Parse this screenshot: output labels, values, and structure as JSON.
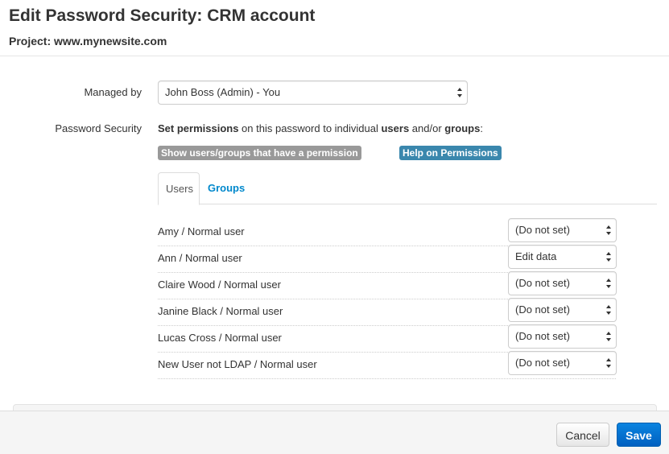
{
  "header": {
    "title": "Edit Password Security: CRM account",
    "subtitle": "Project: www.mynewsite.com"
  },
  "managed_by": {
    "label": "Managed by",
    "value": "John Boss (Admin) - You"
  },
  "password_security": {
    "label": "Password Security",
    "text_prefix_bold": "Set permissions",
    "text_middle": " on this password to individual ",
    "text_users_bold": "users",
    "text_andor": " and/or ",
    "text_groups_bold": "groups",
    "text_suffix": ":",
    "show_button_label": "Show users/groups that have a permission",
    "help_button_label": "Help on Permissions"
  },
  "tabs": [
    {
      "label": "Users",
      "active": true
    },
    {
      "label": "Groups",
      "active": false
    }
  ],
  "users": [
    {
      "name": "Amy / Normal user",
      "permission": "(Do not set)"
    },
    {
      "name": "Ann / Normal user",
      "permission": "Edit data"
    },
    {
      "name": "Claire Wood / Normal user",
      "permission": "(Do not set)"
    },
    {
      "name": "Janine Black / Normal user",
      "permission": "(Do not set)"
    },
    {
      "name": "Lucas Cross / Normal user",
      "permission": "(Do not set)"
    },
    {
      "name": "New User not LDAP / Normal user",
      "permission": "(Do not set)"
    }
  ],
  "footer": {
    "cancel_label": "Cancel",
    "save_label": "Save"
  },
  "colors": {
    "link": "#0088cc",
    "help_badge": "#3a87ad",
    "show_badge": "#999999",
    "save_button": "#0070cc"
  }
}
